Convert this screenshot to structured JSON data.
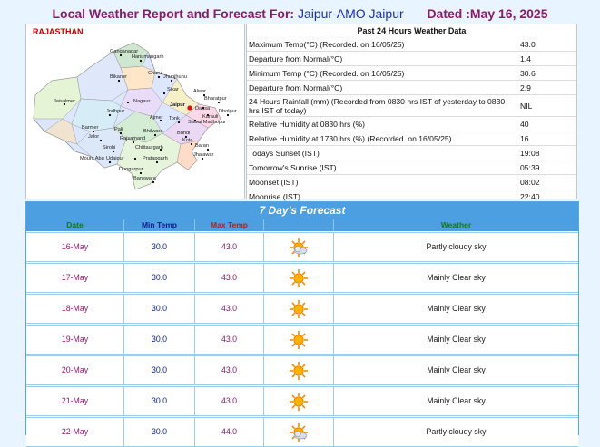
{
  "header": {
    "prefix": "Local Weather Report and Forecast For:",
    "station": "Jaipur-AMO Jaipur",
    "dated": "Dated :May 16, 2025"
  },
  "map": {
    "state_label": "RAJASTHAN",
    "cities": [
      "Ganganagar",
      "Hanumangarh",
      "Churu",
      "Jhunjhunu",
      "Bikaner",
      "Sikar",
      "Alwar",
      "Bharatpur",
      "Jaisalmer",
      "Nagaur",
      "Jaipur",
      "Dausa",
      "Karauli",
      "Dholpur",
      "Jodhpur",
      "Ajmer",
      "Tonk",
      "Sawai Madhopur",
      "Barmer",
      "Pali",
      "Bhilwara",
      "Bundi",
      "Kota",
      "Jalor",
      "Rajsamand",
      "Sirohi",
      "Chittaurgarh",
      "Baran",
      "Mount Abu",
      "Udaipur",
      "Jhalawar",
      "Pratapgarh",
      "Dungarpur",
      "Banswara"
    ]
  },
  "observations": {
    "title": "Past 24 Hours Weather Data",
    "rows": [
      {
        "label": "Maximum Temp(°C) (Recorded. on 16/05/25)",
        "value": "43.0"
      },
      {
        "label": "Departure from Normal(°C)",
        "value": "1.4"
      },
      {
        "label": "Minimum Temp (°C) (Recorded. on 16/05/25)",
        "value": "30.6"
      },
      {
        "label": "Departure from Normal(°C)",
        "value": "2.9"
      },
      {
        "label": "24 Hours Rainfall (mm) (Recorded from 0830 hrs IST of yesterday to 0830 hrs IST of today)",
        "value": "NIL"
      },
      {
        "label": "Relative Humidity at 0830 hrs (%)",
        "value": "40"
      },
      {
        "label": "Relative Humidity at 1730 hrs (%) (Recorded. on 16/05/25)",
        "value": "16"
      },
      {
        "label": "Todays Sunset (IST)",
        "value": "19:08"
      },
      {
        "label": "Tomorrow's Sunrise (IST)",
        "value": "05:39"
      },
      {
        "label": "Moonset (IST)",
        "value": "08:02"
      },
      {
        "label": "Moonrise (IST)",
        "value": "22:40"
      }
    ]
  },
  "forecast": {
    "title": "7 Day's Forecast",
    "headers": {
      "date": "Date",
      "min": "Min Temp",
      "max": "Max Temp",
      "weather": "Weather"
    },
    "rows": [
      {
        "date": "16-May",
        "min": "30.0",
        "max": "43.0",
        "icon": "partly-cloudy-icon",
        "weather": "Partly cloudy sky"
      },
      {
        "date": "17-May",
        "min": "30.0",
        "max": "43.0",
        "icon": "sun-icon",
        "weather": "Mainly Clear sky"
      },
      {
        "date": "18-May",
        "min": "30.0",
        "max": "43.0",
        "icon": "sun-icon",
        "weather": "Mainly Clear sky"
      },
      {
        "date": "19-May",
        "min": "30.0",
        "max": "43.0",
        "icon": "sun-icon",
        "weather": "Mainly Clear sky"
      },
      {
        "date": "20-May",
        "min": "30.0",
        "max": "43.0",
        "icon": "sun-icon",
        "weather": "Mainly Clear sky"
      },
      {
        "date": "21-May",
        "min": "30.0",
        "max": "43.0",
        "icon": "sun-icon",
        "weather": "Mainly Clear sky"
      },
      {
        "date": "22-May",
        "min": "30.0",
        "max": "44.0",
        "icon": "partly-cloudy-icon",
        "weather": "Partly cloudy sky"
      }
    ]
  },
  "colors": {
    "page_bg": "#e8f4ff",
    "title_label": "#8b1a6b",
    "title_station": "#1a2eb8",
    "forecast_header_bg": "#4c9fe0",
    "date_green": "#127a12",
    "min_blue": "#0a1f8f",
    "max_red": "#c01a1a"
  }
}
